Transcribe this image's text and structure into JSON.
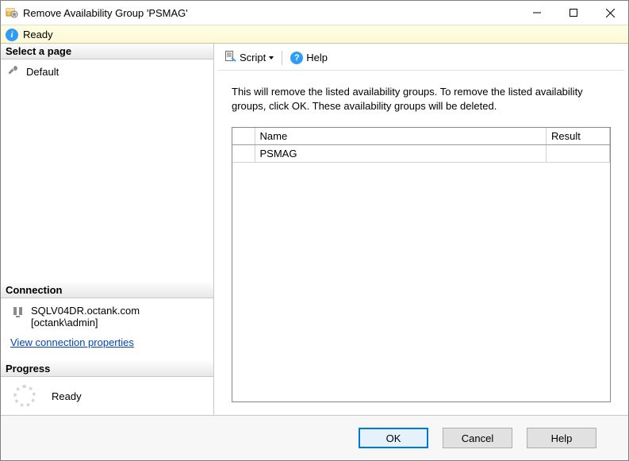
{
  "window": {
    "title": "Remove Availability Group 'PSMAG'"
  },
  "status": {
    "text": "Ready"
  },
  "sidebar": {
    "select_page_header": "Select a page",
    "pages": [
      {
        "label": "Default"
      }
    ],
    "connection_header": "Connection",
    "server": "SQLV04DR.octank.com",
    "user": "[octank\\admin]",
    "view_conn_props": "View connection properties",
    "progress_header": "Progress",
    "progress_text": "Ready"
  },
  "toolbar": {
    "script_label": "Script",
    "help_label": "Help"
  },
  "main": {
    "description": "This will remove the listed availability groups. To remove the listed availability groups, click OK. These availability groups will be deleted.",
    "columns": {
      "name": "Name",
      "result": "Result"
    },
    "rows": [
      {
        "name": "PSMAG",
        "result": ""
      }
    ]
  },
  "footer": {
    "ok": "OK",
    "cancel": "Cancel",
    "help": "Help"
  }
}
